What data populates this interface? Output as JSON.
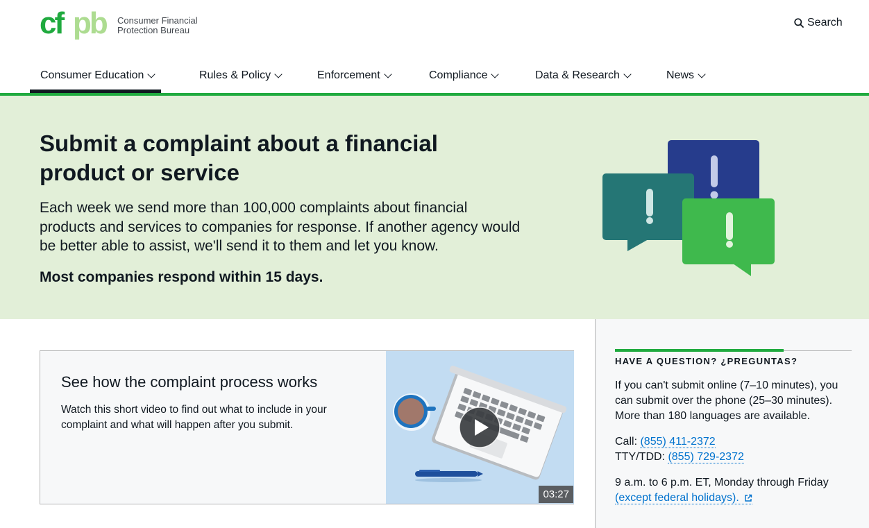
{
  "header": {
    "logo_mark": "cfpb",
    "logo_line1": "Consumer Financial",
    "logo_line2": "Protection Bureau",
    "search_label": "Search",
    "nav": [
      {
        "label": "Consumer Education",
        "active": true
      },
      {
        "label": "Rules & Policy",
        "active": false
      },
      {
        "label": "Enforcement",
        "active": false
      },
      {
        "label": "Compliance",
        "active": false
      },
      {
        "label": "Data & Research",
        "active": false
      },
      {
        "label": "News",
        "active": false
      }
    ]
  },
  "hero": {
    "title": "Submit a complaint about a financial product or service",
    "lead": "Each week we send more than 100,000 complaints about financial products and services to companies for response. If another agency would be better able to assist, we'll send it to them and let you know.",
    "emphasis": "Most companies respond within 15 days.",
    "icon": "speech-bubbles-exclamation-icon"
  },
  "video": {
    "title": "See how the complaint process works",
    "description": "Watch this short video to find out what to include in your complaint and what will happen after you submit.",
    "duration": "03:27",
    "icon": "play-icon"
  },
  "sidebar": {
    "heading": "HAVE A QUESTION? ¿PREGUNTAS?",
    "body": "If you can't submit online (7–10 minutes), you can submit over the phone (25–30 minutes). More than 180 languages are available.",
    "call_label": "Call:",
    "call_number": "(855) 411-2372",
    "tty_label": "TTY/TDD:",
    "tty_number": "(855) 729-2372",
    "hours": "9 a.m. to 6 p.m. ET, Monday through Friday",
    "holidays_link": "(except federal holidays)."
  },
  "colors": {
    "brand_green": "#20aa3f",
    "hero_bg": "#e2efd8",
    "link_blue": "#0072ce",
    "navy": "#263c8c",
    "teal": "#257675",
    "bright_green": "#3fb94d"
  }
}
